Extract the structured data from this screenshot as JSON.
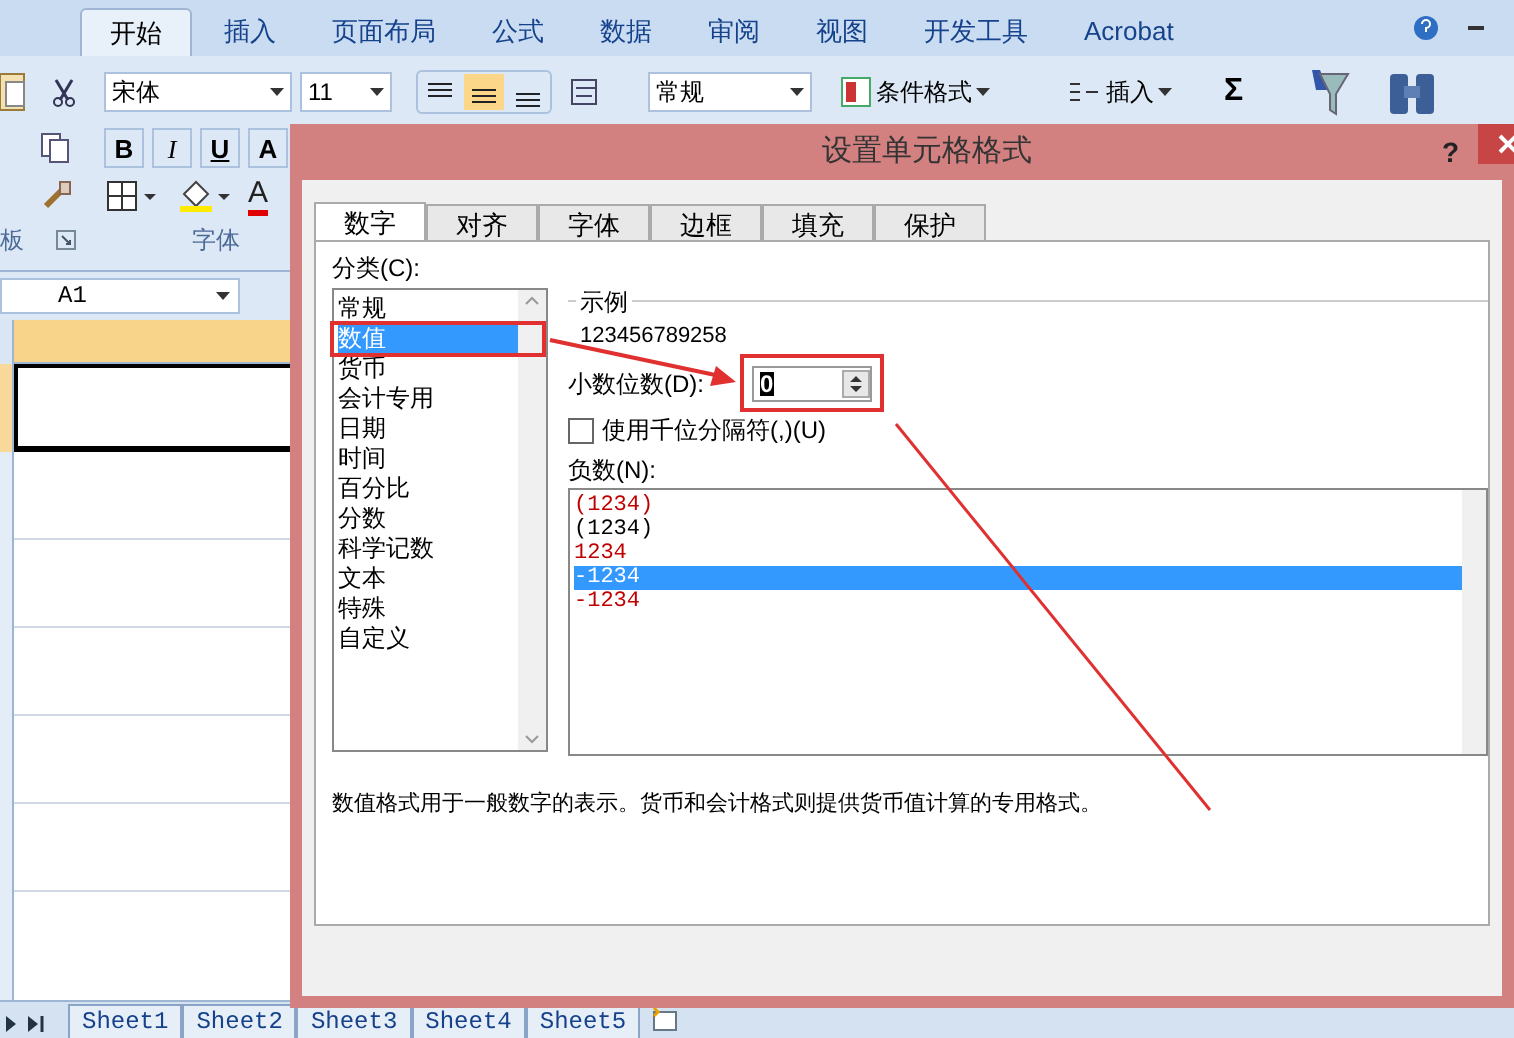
{
  "ribbon_tabs": [
    {
      "label": "开始",
      "selected": true
    },
    {
      "label": "插入",
      "selected": false
    },
    {
      "label": "页面布局",
      "selected": false
    },
    {
      "label": "公式",
      "selected": false
    },
    {
      "label": "数据",
      "selected": false
    },
    {
      "label": "审阅",
      "selected": false
    },
    {
      "label": "视图",
      "selected": false
    },
    {
      "label": "开发工具",
      "selected": false
    },
    {
      "label": "Acrobat",
      "selected": false
    }
  ],
  "ribbon": {
    "font_name": "宋体",
    "font_size": "11",
    "number_format": "常规",
    "conditional_format": "条件格式",
    "insert": "插入",
    "sum": "Σ",
    "format_buttons": [
      "B",
      "I",
      "U",
      "A"
    ],
    "font_color": "A",
    "group_labels": [
      "板",
      "字体"
    ]
  },
  "name_box": "A1",
  "sheet_tabs": [
    {
      "label": "Sheet1"
    },
    {
      "label": "Sheet2"
    },
    {
      "label": "Sheet3"
    },
    {
      "label": "Sheet4"
    },
    {
      "label": "Sheet5"
    }
  ],
  "dialog": {
    "title": "设置单元格格式",
    "help": "?",
    "tabs": [
      {
        "label": "数字",
        "selected": true
      },
      {
        "label": "对齐",
        "selected": false
      },
      {
        "label": "字体",
        "selected": false
      },
      {
        "label": "边框",
        "selected": false
      },
      {
        "label": "填充",
        "selected": false
      },
      {
        "label": "保护",
        "selected": false
      }
    ],
    "category_label": "分类(C):",
    "categories": [
      {
        "label": "常规",
        "selected": false
      },
      {
        "label": "数值",
        "selected": true
      },
      {
        "label": "货币",
        "selected": false
      },
      {
        "label": "会计专用",
        "selected": false
      },
      {
        "label": "日期",
        "selected": false
      },
      {
        "label": "时间",
        "selected": false
      },
      {
        "label": "百分比",
        "selected": false
      },
      {
        "label": "分数",
        "selected": false
      },
      {
        "label": "科学记数",
        "selected": false
      },
      {
        "label": "文本",
        "selected": false
      },
      {
        "label": "特殊",
        "selected": false
      },
      {
        "label": "自定义",
        "selected": false
      }
    ],
    "sample_label": "示例",
    "sample_value": "123456789258",
    "decimal_label": "小数位数(D):",
    "decimal_value": "0",
    "thousands": {
      "label": "使用千位分隔符(,)(U)",
      "checked": false
    },
    "negative_label": "负数(N):",
    "negative_formats": [
      {
        "label": "(1234)",
        "color": "#c00000",
        "selected": false
      },
      {
        "label": "(1234)",
        "color": "#000000",
        "selected": false
      },
      {
        "label": "1234",
        "color": "#c00000",
        "selected": false
      },
      {
        "label": "-1234",
        "selected": true
      },
      {
        "label": "-1234",
        "color": "#c00000",
        "selected": false
      }
    ],
    "description": "数值格式用于一般数字的表示。货币和会计格式则提供货币值计算的专用格式。"
  }
}
